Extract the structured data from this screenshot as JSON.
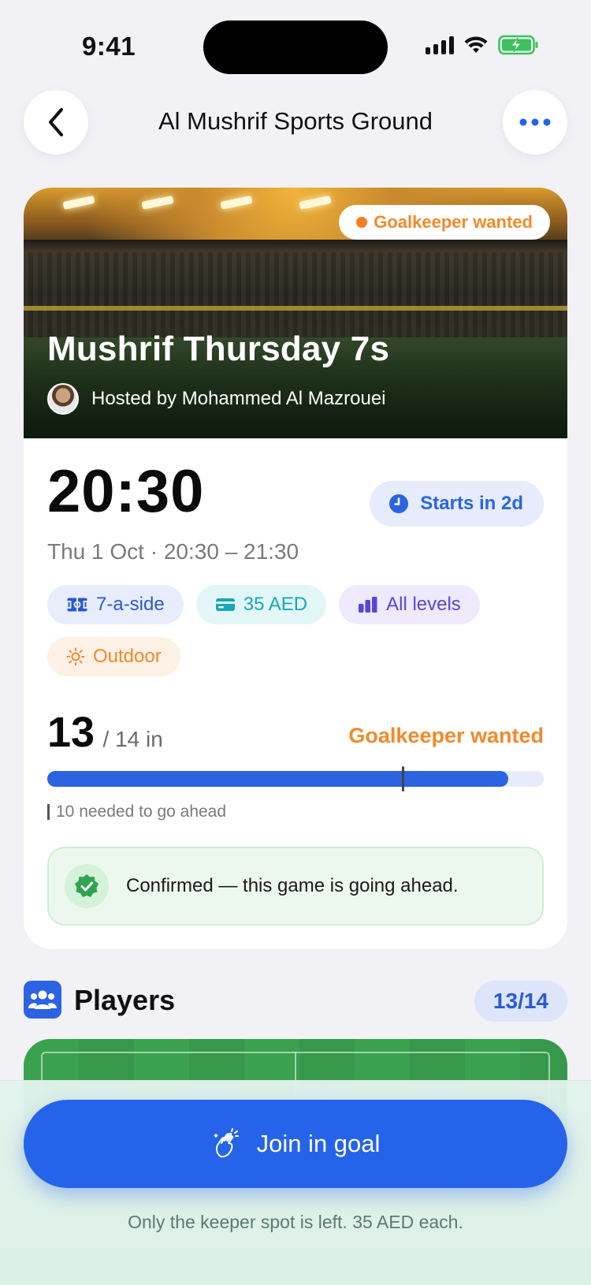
{
  "status_bar": {
    "time": "9:41"
  },
  "nav": {
    "title": "Al Mushrif Sports Ground"
  },
  "hero": {
    "badge": "Goalkeeper wanted",
    "title": "Mushrif Thursday 7s",
    "host": "Hosted by Mohammed Al Mazrouei"
  },
  "schedule": {
    "time": "20:30",
    "date_line": "Thu 1 Oct · 20:30 – 21:30",
    "starts_in": "Starts in 2d"
  },
  "chips": [
    {
      "label": "7-a-side",
      "icon": "pitch-icon"
    },
    {
      "label": "35 AED",
      "icon": "card-icon"
    },
    {
      "label": "All levels",
      "icon": "bars-icon"
    },
    {
      "label": "Outdoor",
      "icon": "sun-icon"
    }
  ],
  "attendance": {
    "count": "13",
    "capacity_label": "/ 14 in",
    "status": "Goalkeeper wanted",
    "fill_fraction": 0.928,
    "threshold_fraction": 0.714,
    "threshold_label": "10 needed to go ahead"
  },
  "confirmation": {
    "text": "Confirmed — this game is going ahead."
  },
  "players": {
    "title": "Players",
    "count": "13/14"
  },
  "cta": {
    "label": "Join in goal",
    "note": "Only the keeper spot is left. 35 AED each."
  },
  "colors": {
    "accent": "#2563eb",
    "warning": "#f28a2a",
    "success": "#2ea44f"
  }
}
